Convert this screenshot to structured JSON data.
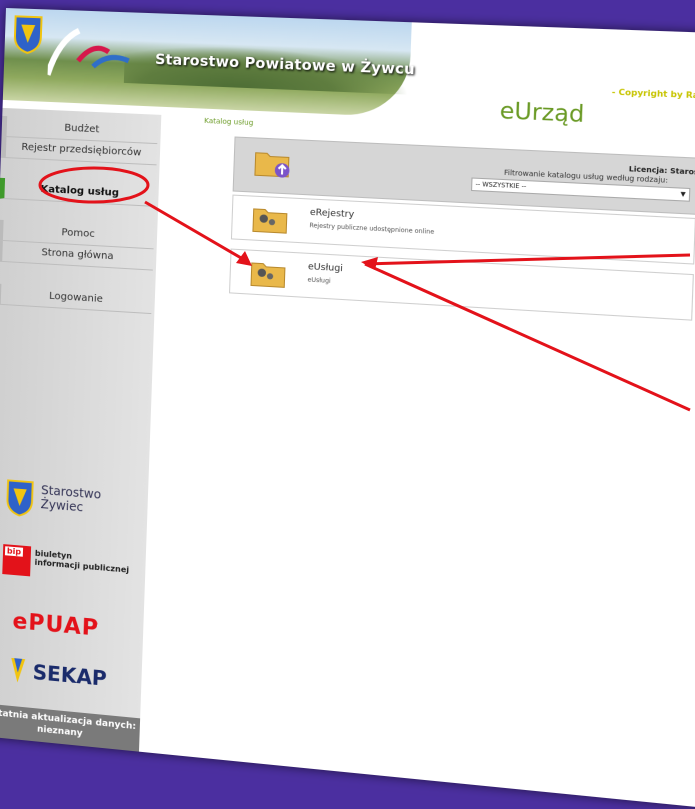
{
  "banner": {
    "title": "Starostwo Powiatowe w Żywcu",
    "app_name": "eUrząd",
    "copyright": "- Copyright by Rafał"
  },
  "nav": {
    "items": [
      {
        "label": "Budżet"
      },
      {
        "label": "Rejestr przedsiębiorców"
      },
      {
        "label": "Katalog usług"
      },
      {
        "label": "Pomoc"
      },
      {
        "label": "Strona główna"
      },
      {
        "label": "Logowanie"
      }
    ]
  },
  "breadcrumb": "Katalog usług",
  "license": "Licencja: Starostwo Żyw",
  "filter": {
    "label": "Filtrowanie katalogu usług według rodzaju:",
    "selected": "-- WSZYSTKIE --"
  },
  "services": [
    {
      "title": "eRejestry",
      "description": "Rejestry publiczne udostępnione online"
    },
    {
      "title": "eUsługi",
      "description": "eUsługi"
    }
  ],
  "side_logos": {
    "starostwo_line1": "Starostwo",
    "starostwo_line2": "Żywiec",
    "bip_badge": "bip",
    "bip_line1": "biuletyn",
    "bip_line2": "informacji publicznej",
    "epuap": "ePUAP",
    "sekap": "SEKAP"
  },
  "footer": {
    "line1": "Ostatnia aktualizacja danych:",
    "line2": "nieznany"
  },
  "colors": {
    "background": "#4b2fa0",
    "accent_green": "#6a9a25",
    "annotation_red": "#e3121a"
  }
}
